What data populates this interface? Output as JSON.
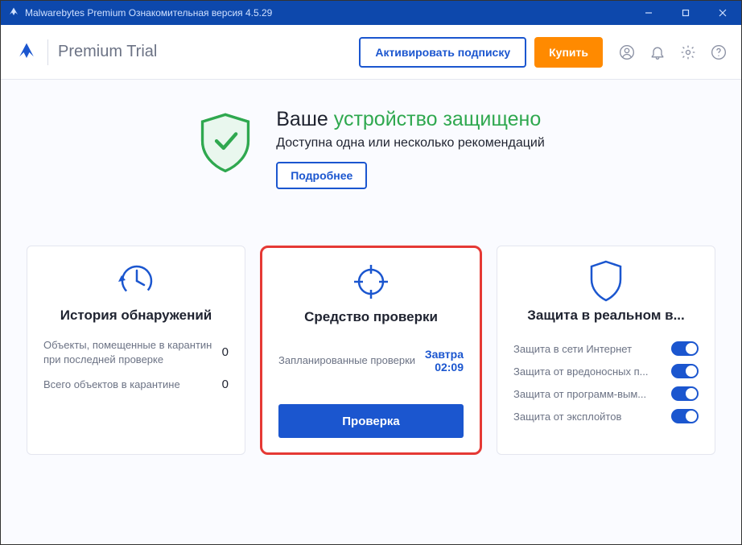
{
  "titlebar": {
    "title": "Malwarebytes Premium Ознакомительная версия  4.5.29"
  },
  "header": {
    "brand": "Premium Trial",
    "activate_label": "Активировать подписку",
    "buy_label": "Купить"
  },
  "status": {
    "prefix": "Ваше ",
    "protected": "устройство защищено",
    "subtitle": "Доступна одна или несколько рекомендаций",
    "more_label": "Подробнее"
  },
  "cards": {
    "history": {
      "title": "История обнаружений",
      "stat1_label": "Объекты, помещенные в карантин при последней проверке",
      "stat1_value": "0",
      "stat2_label": "Всего объектов в карантине",
      "stat2_value": "0"
    },
    "scanner": {
      "title": "Средство проверки",
      "sched_label": "Запланированные проверки",
      "sched_day": "Завтра",
      "sched_time": "02:09",
      "scan_button": "Проверка"
    },
    "rtp": {
      "title": "Защита в реальном в...",
      "items": [
        {
          "label": "Защита в сети Интернет",
          "on": true
        },
        {
          "label": "Защита от вредоносных п...",
          "on": true
        },
        {
          "label": "Защита от программ-вым...",
          "on": true
        },
        {
          "label": "Защита от эксплойтов",
          "on": true
        }
      ]
    }
  }
}
